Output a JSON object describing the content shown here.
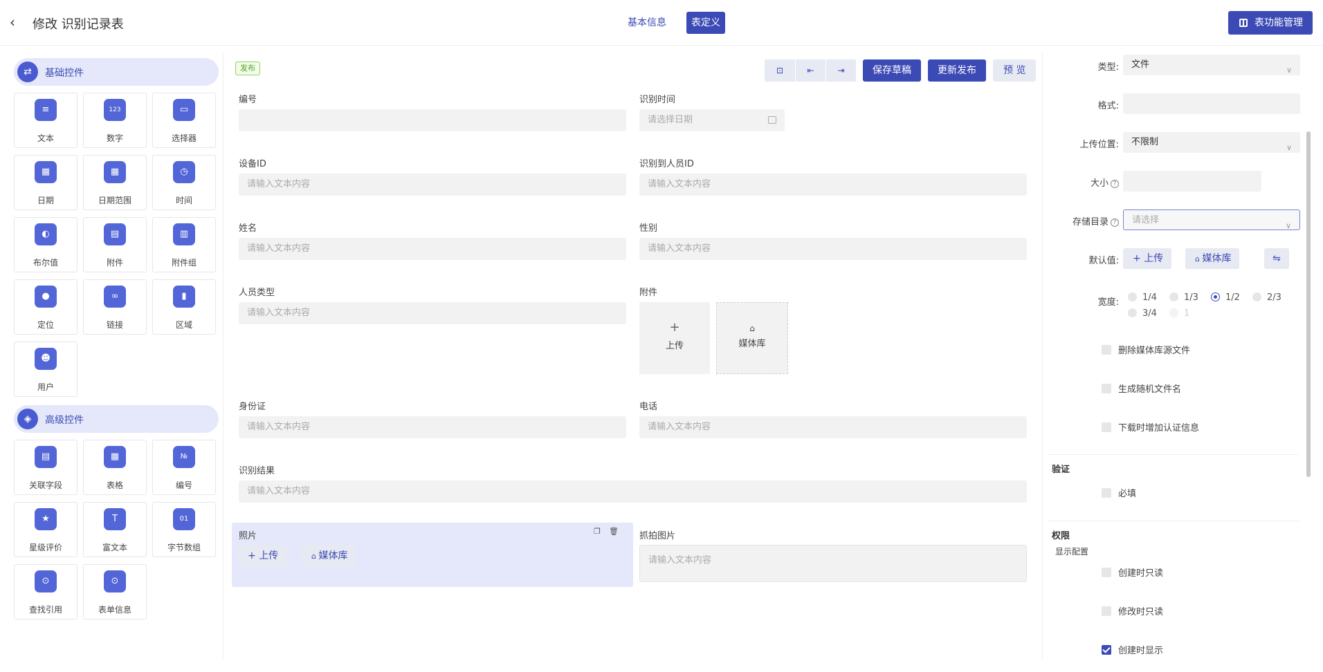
{
  "header": {
    "back_icon": "chevron-left-icon",
    "title": "修改 识别记录表",
    "tabs": [
      {
        "label": "基本信息",
        "active": false
      },
      {
        "label": "表定义",
        "active": true
      }
    ],
    "manage_button": "表功能管理"
  },
  "left_panel": {
    "basic": {
      "title": "基础控件",
      "items": [
        {
          "label": "文本",
          "icon": "text-icon"
        },
        {
          "label": "数字",
          "icon": "number-icon"
        },
        {
          "label": "选择器",
          "icon": "select-icon"
        },
        {
          "label": "日期",
          "icon": "calendar-icon"
        },
        {
          "label": "日期范围",
          "icon": "date-range-icon"
        },
        {
          "label": "时间",
          "icon": "clock-icon"
        },
        {
          "label": "布尔值",
          "icon": "toggle-icon"
        },
        {
          "label": "附件",
          "icon": "attachment-icon"
        },
        {
          "label": "附件组",
          "icon": "attachment-group-icon"
        },
        {
          "label": "定位",
          "icon": "location-icon"
        },
        {
          "label": "链接",
          "icon": "link-icon"
        },
        {
          "label": "区域",
          "icon": "map-icon"
        },
        {
          "label": "用户",
          "icon": "user-icon"
        }
      ]
    },
    "advanced": {
      "title": "高级控件",
      "items": [
        {
          "label": "关联字段",
          "icon": "relation-icon"
        },
        {
          "label": "表格",
          "icon": "table-icon"
        },
        {
          "label": "编号",
          "icon": "serial-number-icon"
        },
        {
          "label": "星级评价",
          "icon": "star-icon"
        },
        {
          "label": "富文本",
          "icon": "rich-text-icon"
        },
        {
          "label": "字节数组",
          "icon": "byte-array-icon"
        },
        {
          "label": "查找引用",
          "icon": "lookup-icon"
        },
        {
          "label": "表单信息",
          "icon": "form-info-icon"
        }
      ]
    }
  },
  "canvas": {
    "status": "发布",
    "toolbar": {
      "save_draft": "保存草稿",
      "update_publish": "更新发布",
      "preview": "预 览"
    },
    "placeholder": "请输入文本内容",
    "date_placeholder": "请选择日期",
    "fields": {
      "number": "编号",
      "recognition_time": "识别时间",
      "device_id": "设备ID",
      "person_id": "识别到人员ID",
      "name": "姓名",
      "gender": "性别",
      "person_type": "人员类型",
      "attachment": "附件",
      "id_card": "身份证",
      "phone": "电话",
      "result": "识别结果",
      "photo": "照片",
      "snapshot": "抓拍图片"
    },
    "upload": "上传",
    "media_library": "媒体库"
  },
  "properties": {
    "type_label": "类型:",
    "type_value": "文件",
    "format_label": "格式:",
    "upload_pos_label": "上传位置:",
    "upload_pos_value": "不限制",
    "size_label": "大小",
    "storage_label": "存储目录",
    "storage_placeholder": "请选择",
    "default_label": "默认值:",
    "upload": "上传",
    "media_library": "媒体库",
    "width_label": "宽度:",
    "widths": [
      "1/4",
      "1/3",
      "1/2",
      "2/3",
      "3/4",
      "1"
    ],
    "selected_width": "1/2",
    "options": [
      {
        "label": "删除媒体库源文件",
        "checked": false
      },
      {
        "label": "生成随机文件名",
        "checked": false
      },
      {
        "label": "下载时增加认证信息",
        "checked": false
      }
    ],
    "validation_title": "验证",
    "required": "必填",
    "permission_title": "权限",
    "display_config": "显示配置",
    "permissions": [
      {
        "label": "创建时只读",
        "checked": false
      },
      {
        "label": "修改时只读",
        "checked": false
      },
      {
        "label": "创建时显示",
        "checked": true
      }
    ]
  }
}
